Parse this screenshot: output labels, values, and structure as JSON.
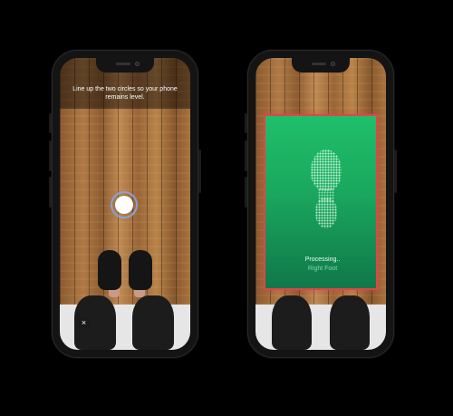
{
  "capture_screen": {
    "instruction": "Line up the two circles so your phone remains level.",
    "close_icon": "×"
  },
  "processing_screen": {
    "status": "Processing..",
    "foot": "Right Foot"
  },
  "colors": {
    "scan_green": "#1aa75d",
    "scan_border": "#d94848",
    "level_ring": "#8aa0d8"
  }
}
